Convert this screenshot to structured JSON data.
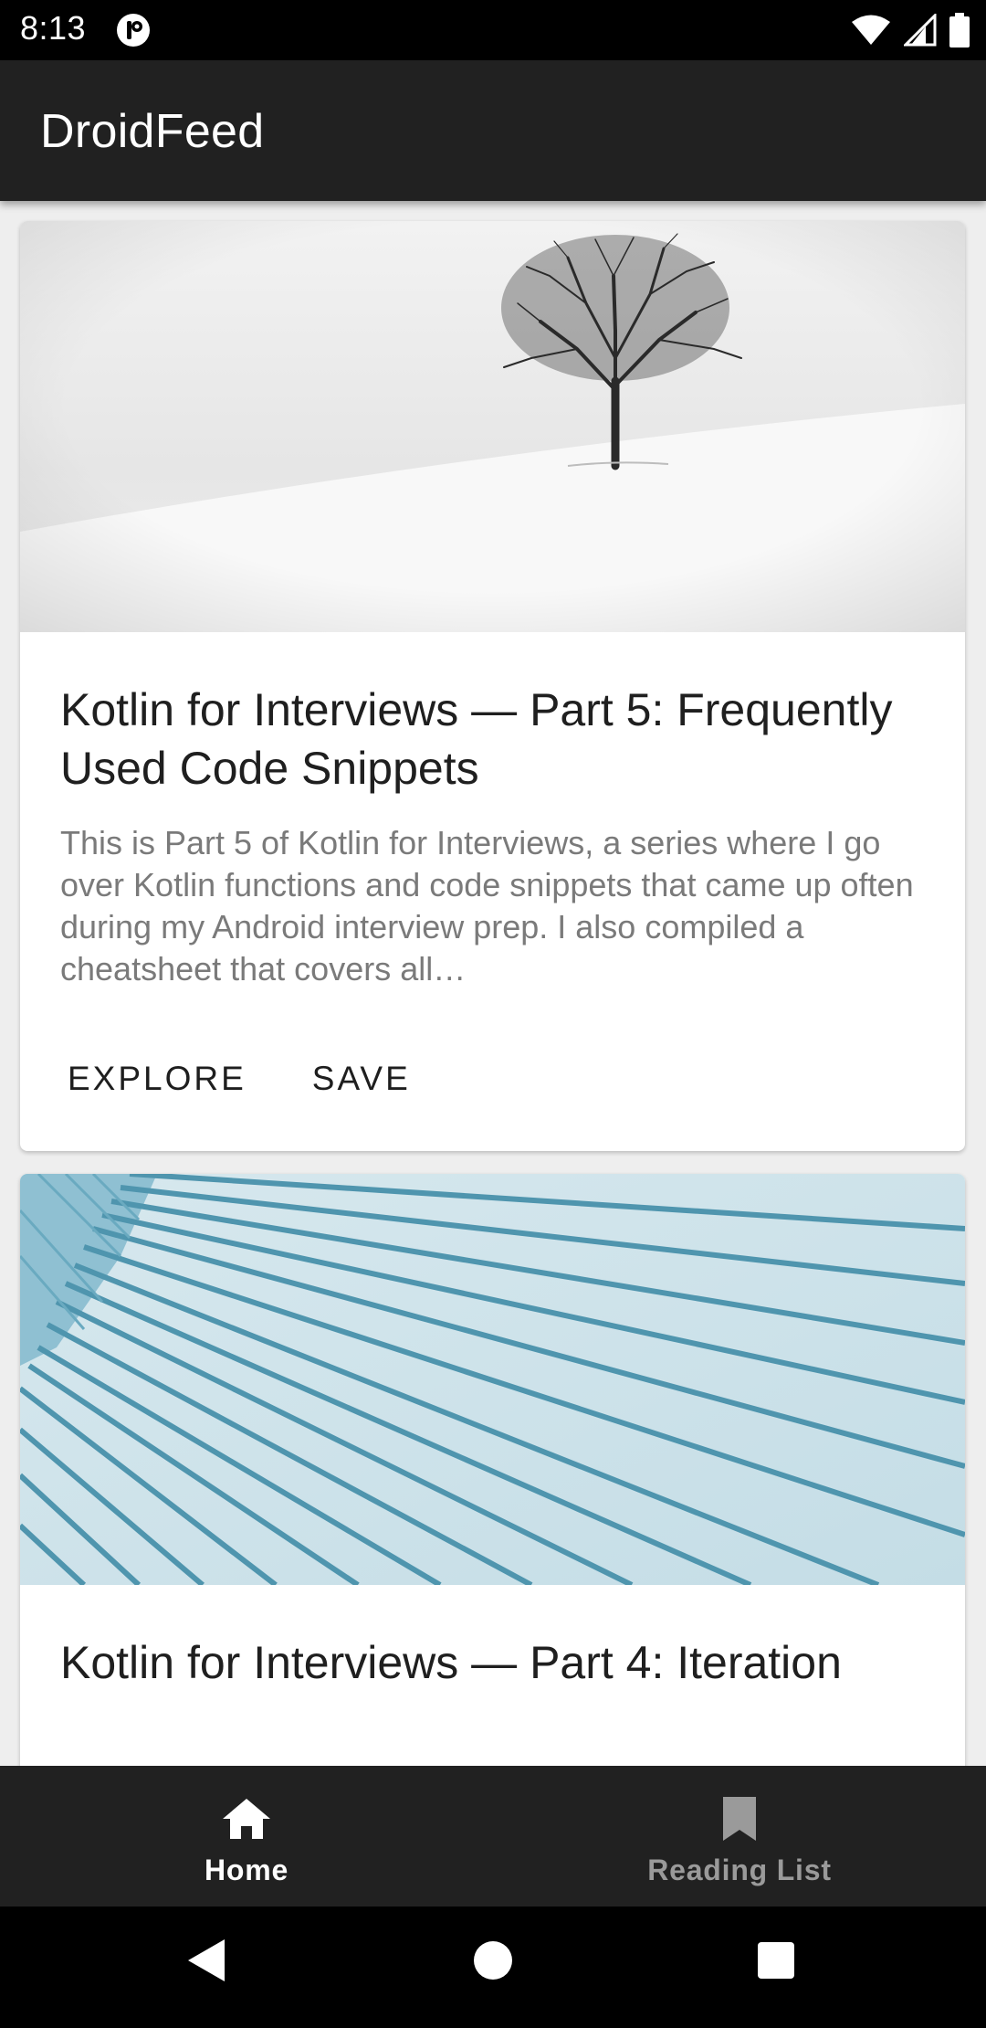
{
  "status_bar": {
    "time": "8:13",
    "icons": [
      "app-notification-icon",
      "wifi-icon",
      "cellular-signal-icon",
      "battery-icon"
    ]
  },
  "app_bar": {
    "title": "DroidFeed"
  },
  "feed": {
    "cards": [
      {
        "image": "minimalist-tree-in-snow-image",
        "title": "Kotlin for Interviews — Part 5: Frequently Used Code Snippets",
        "description": "This is Part 5 of Kotlin for Interviews, a series where I go over Kotlin functions and code snippets that came up often during my Android interview prep. I also compiled a cheatsheet that covers all…",
        "actions": {
          "explore": "EXPLORE",
          "save": "SAVE"
        }
      },
      {
        "image": "teal-architectural-lines-image",
        "title": "Kotlin for Interviews — Part 4: Iteration"
      }
    ]
  },
  "bottom_nav": {
    "items": [
      {
        "label": "Home",
        "icon": "home-icon",
        "active": true
      },
      {
        "label": "Reading List",
        "icon": "bookmark-icon",
        "active": false
      }
    ]
  },
  "colors": {
    "app_bar": "#212121",
    "bottom_nav": "#212121",
    "status_bar": "#000000",
    "title_text": "#1f1f1f",
    "body_text": "#7a7a7a",
    "nav_active": "#ffffff",
    "nav_inactive": "#9a9a9a"
  }
}
